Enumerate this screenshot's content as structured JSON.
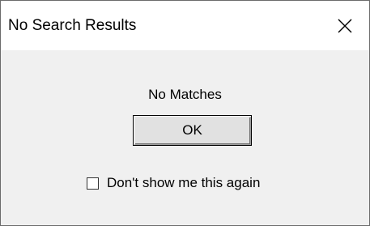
{
  "dialog": {
    "title": "No Search Results",
    "message": "No Matches",
    "ok_label": "OK",
    "checkbox": {
      "label": "Don't show me this again",
      "checked": false
    }
  },
  "icons": {
    "close": "close-icon"
  },
  "colors": {
    "titlebar_bg": "#ffffff",
    "body_bg": "#f0f0f0",
    "button_bg": "#e1e1e1",
    "border": "#6b6b6b"
  }
}
